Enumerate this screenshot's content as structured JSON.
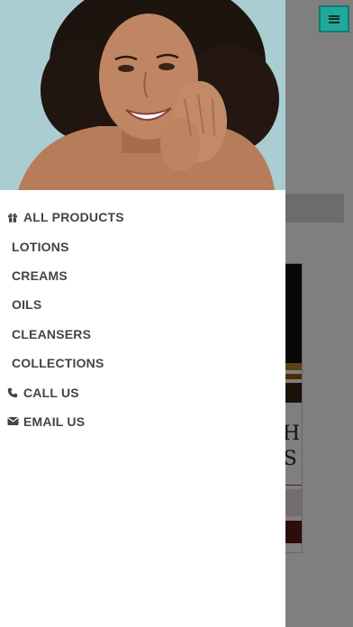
{
  "menu": {
    "items": [
      {
        "label": "ALL PRODUCTS",
        "icon": "gift-icon",
        "level": "top"
      },
      {
        "label": "LOTIONS",
        "level": "sub"
      },
      {
        "label": "CREAMS",
        "level": "sub"
      },
      {
        "label": "OILS",
        "level": "sub"
      },
      {
        "label": "CLEANSERS",
        "level": "sub"
      },
      {
        "label": "COLLECTIONS",
        "level": "sub"
      },
      {
        "label": "CALL US",
        "icon": "phone-icon",
        "level": "top"
      },
      {
        "label": "EMAIL US",
        "icon": "envelope-icon",
        "level": "top"
      }
    ]
  },
  "background": {
    "card_text": "CH\nGS"
  },
  "colors": {
    "accent": "#1fa99a",
    "menu_text": "#444444",
    "hero_bg": "#a9cdd0"
  },
  "icons": {
    "menu_button": "hamburger-icon"
  }
}
